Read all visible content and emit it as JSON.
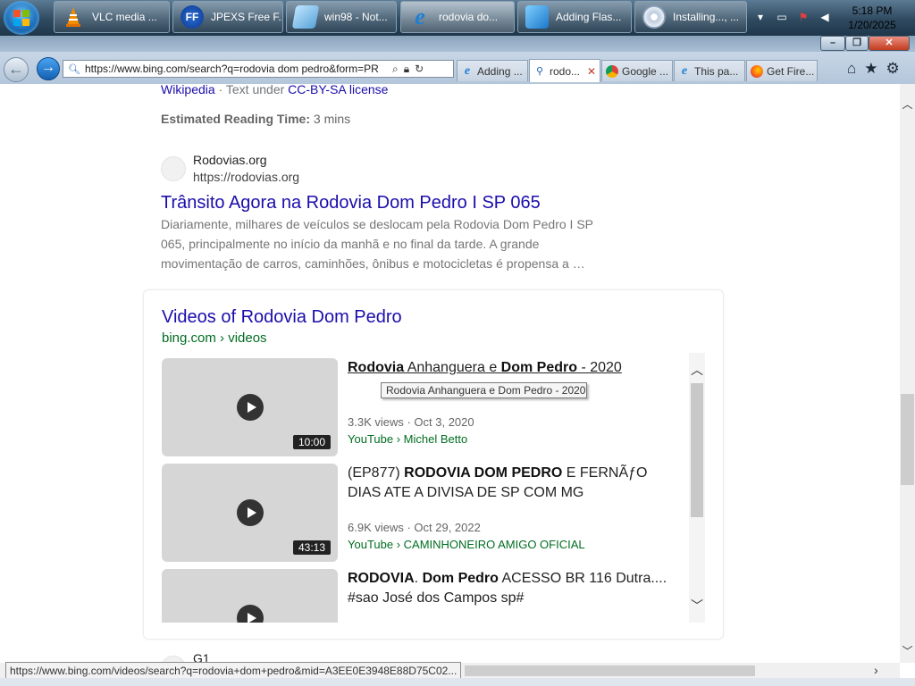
{
  "taskbar": {
    "buttons": [
      {
        "label": "VLC media ...",
        "icon": "vlc-cone-icon"
      },
      {
        "label": "JPEXS Free F...",
        "icon": "ffdec-icon",
        "icon_text": "FF"
      },
      {
        "label": "win98 - Not...",
        "icon": "notepad-icon"
      },
      {
        "label": "rodovia do...",
        "icon": "ie-icon"
      },
      {
        "label": "Adding Flas...",
        "icon": "installer-icon"
      },
      {
        "label": "Installing..., ...",
        "icon": "setup-cd-icon"
      }
    ],
    "clock": {
      "time": "5:18 PM",
      "date": "1/20/2025"
    }
  },
  "browser": {
    "address": "https://www.bing.com/search?q=rodovia dom pedro&form=PR",
    "tabs": [
      {
        "label": "Adding ...",
        "icon": "ie-icon"
      },
      {
        "label": "rodo...",
        "icon": "search-icon",
        "active": true
      },
      {
        "label": "Google ...",
        "icon": "chrome-icon"
      },
      {
        "label": "This pa...",
        "icon": "ie-icon"
      },
      {
        "label": "Get Fire...",
        "icon": "firefox-icon"
      }
    ]
  },
  "content": {
    "wiki_source": "Wikipedia",
    "wiki_sep": " · Text under ",
    "wiki_license": "CC-BY-SA license",
    "reading_label": "Estimated Reading Time:",
    "reading_value": " 3 mins",
    "result1": {
      "site_name": "Rodovias.org",
      "site_url": "https://rodovias.org",
      "title": "Trânsito Agora na Rodovia Dom Pedro I SP 065",
      "snippet": "Diariamente, milhares de veículos se deslocam pela Rodovia Dom Pedro I SP 065, principalmente no início da manhã e no final da tarde. A grande movimentação de carros, caminhões, ônibus e motocicletas é propensa a …"
    },
    "videos": {
      "heading": "Videos of Rodovia Dom Pedro",
      "source": "bing.com › videos",
      "items": [
        {
          "t1": "Rodovia",
          "t2": " Anhanguera e ",
          "t3": "Dom Pedro",
          "t4": " - 2020",
          "duration": "10:00",
          "meta": "3.3K views · Oct 3, 2020",
          "channel": "YouTube › Michel Betto"
        },
        {
          "t1": "(EP877) ",
          "t2": "RODOVIA DOM PEDRO",
          "t3": " E FERNÃƒO DIAS ATE A DIVISA DE SP COM MG",
          "duration": "43:13",
          "meta": "6.9K views · Oct 29, 2022",
          "channel": "YouTube › CAMINHONEIRO AMIGO OFICIAL"
        },
        {
          "t1": "RODOVIA",
          "t2": ". ",
          "t3": "Dom Pedro",
          "t4": " ACESSO BR 116 Dutra.... #sao José dos Campos sp#"
        }
      ],
      "tooltip": "Rodovia Anhanguera e Dom Pedro - 2020"
    },
    "result2": {
      "site_name": "G1"
    }
  },
  "status_url": "https://www.bing.com/videos/search?q=rodovia+dom+pedro&mid=A3EE0E3948E88D75C02..."
}
